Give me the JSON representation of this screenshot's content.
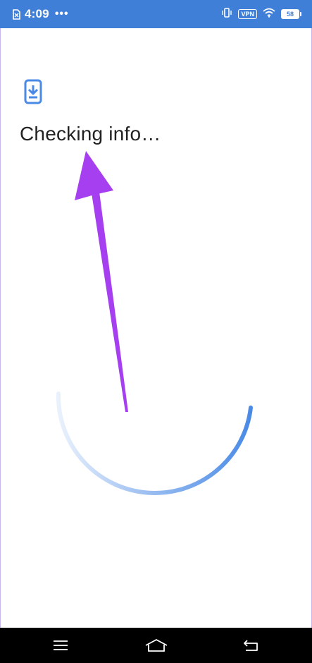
{
  "status_bar": {
    "time": "4:09",
    "more": "•••",
    "vpn": "VPN",
    "battery": "58",
    "icons": [
      "sim-icon",
      "vibrate-icon",
      "wifi-icon",
      "battery-icon"
    ]
  },
  "main": {
    "icon": "phone-download-icon",
    "title": "Checking info…"
  },
  "progress": {
    "type": "arc-spinner"
  },
  "annotation": {
    "icon": "arrow-pointer",
    "color": "#a53ff0"
  },
  "nav_bar": {
    "icons": [
      "menu-icon",
      "home-icon",
      "back-icon"
    ]
  },
  "colors": {
    "status_bar": "#3f7fd8",
    "accent": "#4a8ae6",
    "arrow": "#a53ff0",
    "title_text": "#222222"
  }
}
